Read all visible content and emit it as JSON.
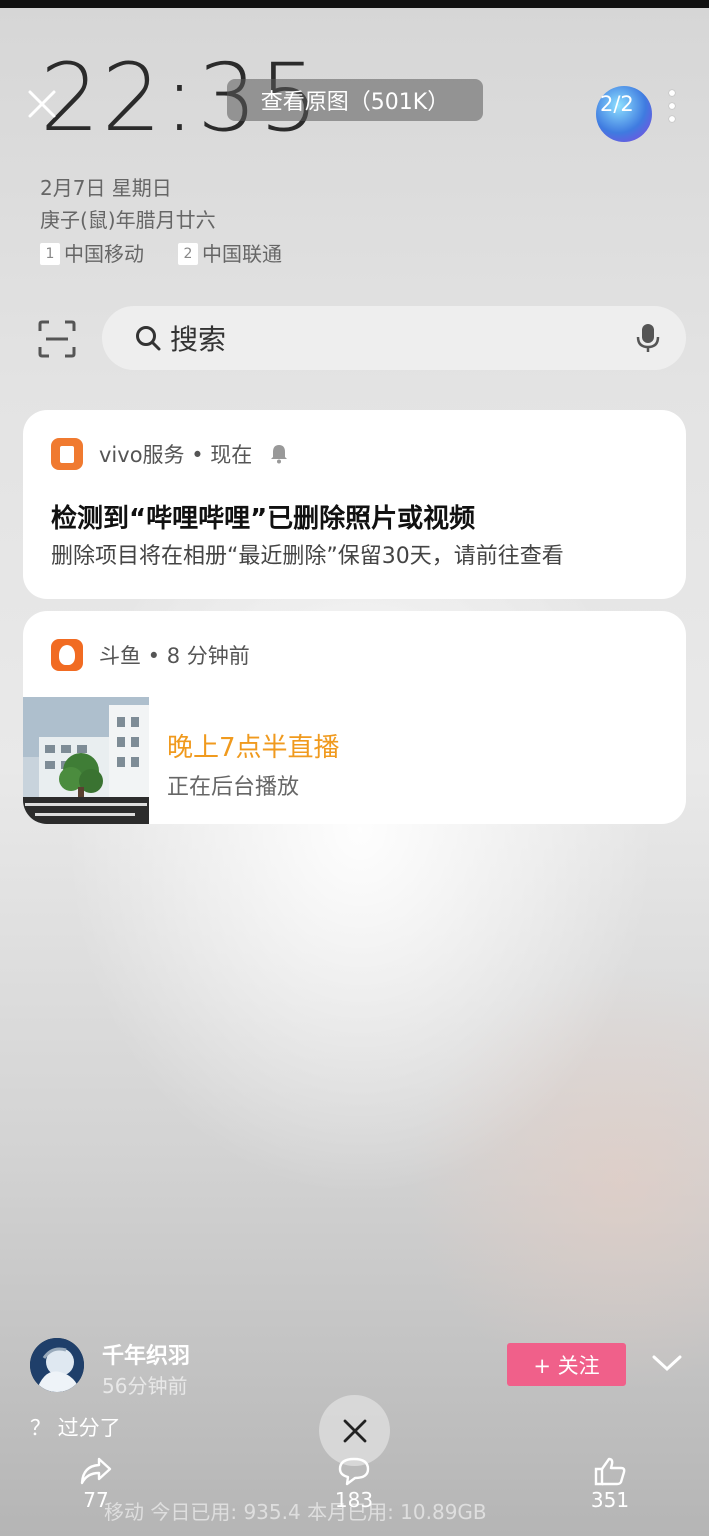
{
  "lockscreen": {
    "time": "22:35",
    "date": "2月7日 星期日",
    "lunar": "庚子(鼠)年腊月廿六",
    "sims": [
      {
        "slot": "1",
        "carrier": "中国移动"
      },
      {
        "slot": "2",
        "carrier": "中国联通"
      }
    ],
    "search_placeholder": "搜索"
  },
  "viewer": {
    "view_original_label": "查看原图（501K）",
    "page_counter": "2/2"
  },
  "notifications": [
    {
      "app": "vivo服务 • 现在",
      "title": "检测到“哔哩哔哩”已删除照片或视频",
      "body": "删除项目将在相册“最近删除”保留30天，请前往查看"
    },
    {
      "app": "斗鱼 • 8 分钟前",
      "title": "晚上7点半直播",
      "body": "正在后台播放"
    }
  ],
  "post": {
    "username": "千年织羽",
    "time_ago": "56分钟前",
    "follow_label": "+ 关注",
    "caption": "？ 过分了",
    "share_count": "77",
    "comment_count": "183",
    "like_count": "351",
    "status_overlay": "移动   今日已用: 935.4      本月已用: 10.89GB"
  },
  "colors": {
    "follow": "#f0608a",
    "accent_orange": "#f09a1e"
  }
}
